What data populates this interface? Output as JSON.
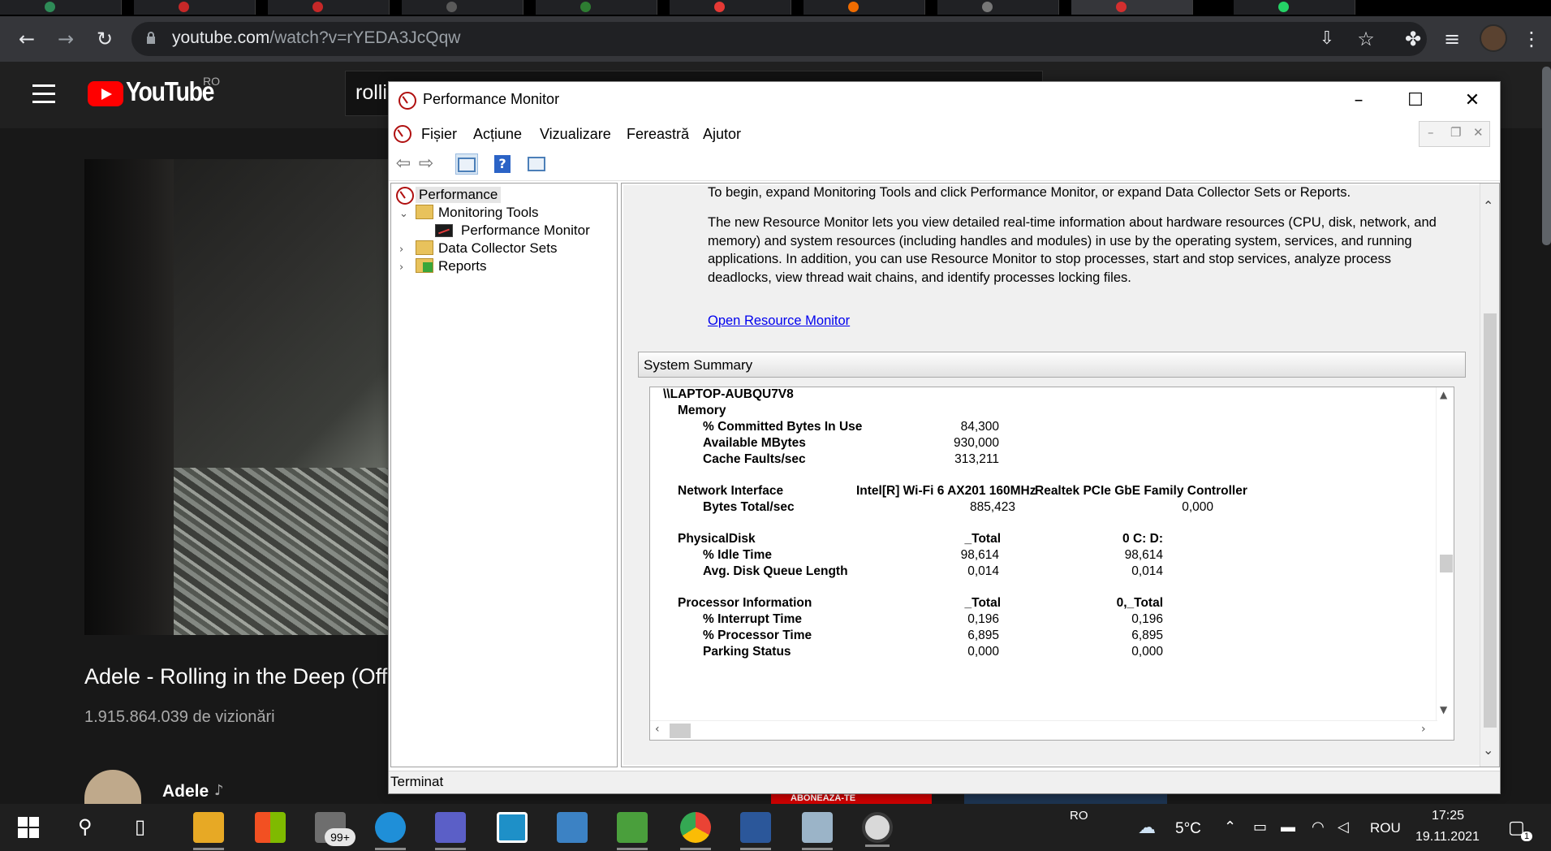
{
  "browser": {
    "url_host": "youtube.com",
    "url_path": "/watch?v=rYEDA3JcQqw"
  },
  "youtube": {
    "logo_text": "YouTube",
    "country_code": "RO",
    "search_value": "rolli",
    "video_title": "Adele - Rolling in the Deep (Offic",
    "views": "1.915.864.039 de vizionări",
    "channel_name": "Adele",
    "subscribe_banner": "ABONEAZĂ-TE"
  },
  "perfmon": {
    "window_title": "Performance Monitor",
    "menu": [
      "Fișier",
      "Acțiune",
      "Vizualizare",
      "Fereastră",
      "Ajutor"
    ],
    "tree": {
      "root": "Performance",
      "monitoring_tools": "Monitoring Tools",
      "performance_monitor": "Performance Monitor",
      "data_collector_sets": "Data Collector Sets",
      "reports": "Reports"
    },
    "intro_text_1": "To begin, expand Monitoring Tools and click Performance Monitor, or expand Data Collector Sets or Reports.",
    "intro_text_2": "The new Resource Monitor lets you view detailed real-time information about hardware resources (CPU, disk, network, and memory) and system resources (including handles and modules) in use by the operating system, services, and running applications. In addition, you can use Resource Monitor to stop processes, start and stop services, analyze process deadlocks, view thread wait chains, and identify processes locking files.",
    "resource_monitor_link": "Open Resource Monitor",
    "system_summary_label": "System Summary",
    "summary": {
      "host": "\\\\LAPTOP-AUBQU7V8",
      "memory_label": "Memory",
      "committed_label": "% Committed Bytes In Use",
      "committed_value": "84,300",
      "available_label": "Available MBytes",
      "available_value": "930,000",
      "cache_label": "Cache Faults/sec",
      "cache_value": "313,211",
      "network_label": "Network Interface",
      "nic1": "Intel[R] Wi-Fi 6 AX201 160MHz",
      "nic2": "Realtek PCIe GbE Family Controller",
      "bytes_label": "Bytes Total/sec",
      "bytes_nic1": "885,423",
      "bytes_nic2": "0,000",
      "disk_label": "PhysicalDisk",
      "disk_col1": "_Total",
      "disk_col2": "0 C: D:",
      "idle_label": "% Idle Time",
      "idle_1": "98,614",
      "idle_2": "98,614",
      "queue_label": "Avg. Disk Queue Length",
      "queue_1": "0,014",
      "queue_2": "0,014",
      "proc_label": "Processor Information",
      "proc_col1": "_Total",
      "proc_col2": "0,_Total",
      "interrupt_label": "% Interrupt Time",
      "interrupt_1": "0,196",
      "interrupt_2": "0,196",
      "proctime_label": "% Processor Time",
      "proctime_1": "6,895",
      "proctime_2": "6,895",
      "parking_label": "Parking Status",
      "parking_1": "0,000",
      "parking_2": "0,000"
    },
    "status_text": "Terminat"
  },
  "taskbar": {
    "mail_badge": "99+",
    "lang_top": "RO",
    "weather": "5°C",
    "lang": "ROU",
    "time": "17:25",
    "date": "19.11.2021",
    "notif_count": "1"
  }
}
